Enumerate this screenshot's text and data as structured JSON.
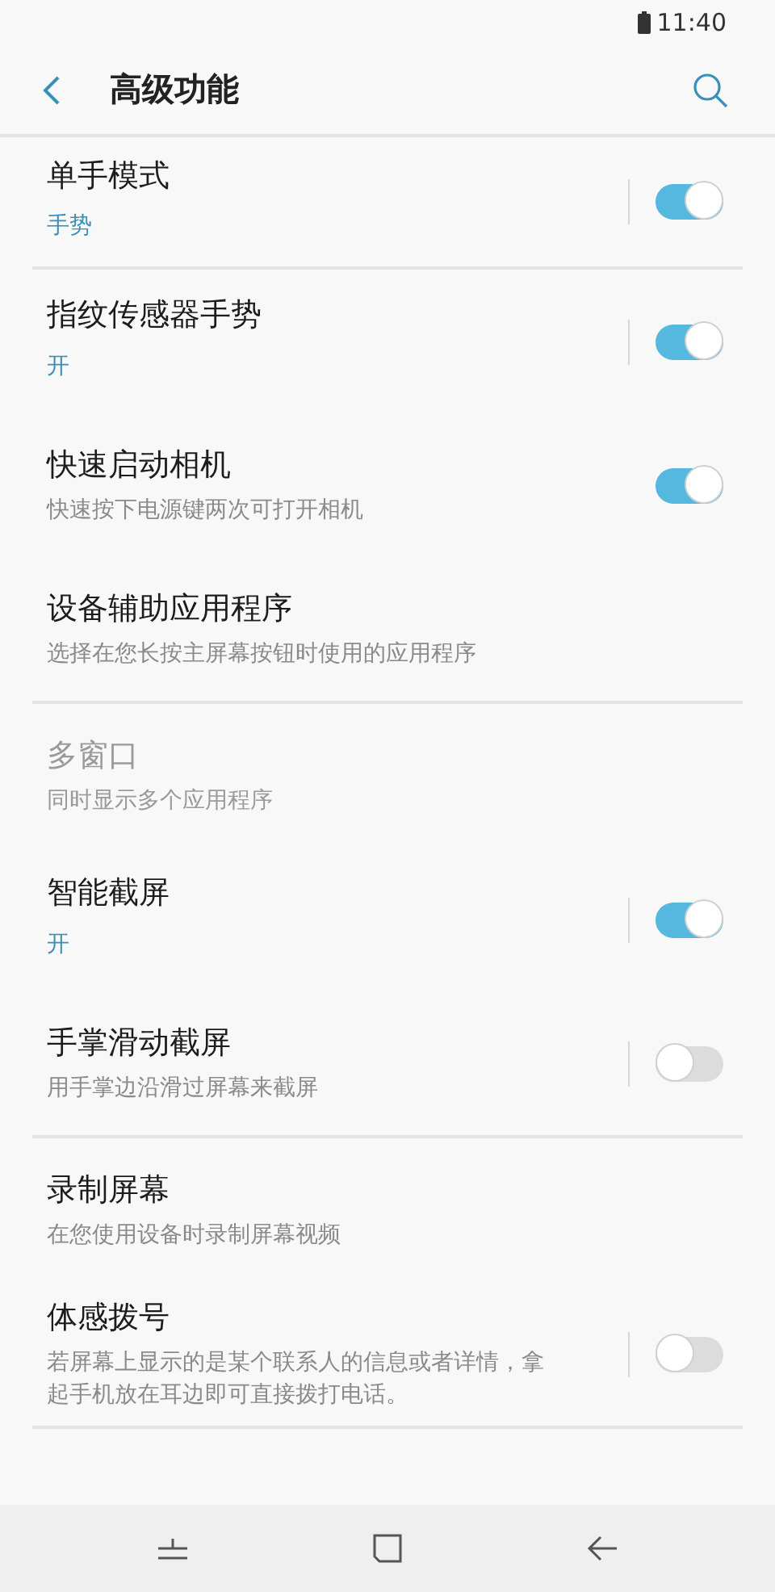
{
  "status_bar": {
    "time": "11:40"
  },
  "header": {
    "title": "高级功能"
  },
  "settings": [
    {
      "kind": "switch",
      "title": "单手模式",
      "subtitle": "手势",
      "subtitle_highlighted": true,
      "split": true,
      "on": true,
      "disabled": false,
      "divider_after": true
    },
    {
      "kind": "switch",
      "title": "指纹传感器手势",
      "subtitle": "开",
      "subtitle_highlighted": true,
      "split": true,
      "on": true,
      "disabled": false,
      "divider_after": false
    },
    {
      "kind": "switch",
      "title": "快速启动相机",
      "subtitle": "快速按下电源键两次可打开相机",
      "subtitle_highlighted": false,
      "split": false,
      "on": true,
      "disabled": false,
      "divider_after": false
    },
    {
      "kind": "plain",
      "title": "设备辅助应用程序",
      "subtitle": "选择在您长按主屏幕按钮时使用的应用程序",
      "subtitle_highlighted": false,
      "split": false,
      "disabled": false,
      "divider_after": true
    },
    {
      "kind": "plain",
      "title": "多窗口",
      "subtitle": "同时显示多个应用程序",
      "subtitle_highlighted": false,
      "split": false,
      "disabled": true,
      "divider_after": false
    },
    {
      "kind": "switch",
      "title": "智能截屏",
      "subtitle": "开",
      "subtitle_highlighted": true,
      "split": true,
      "on": true,
      "disabled": false,
      "divider_after": false
    },
    {
      "kind": "switch",
      "title": "手掌滑动截屏",
      "subtitle": "用手掌边沿滑过屏幕来截屏",
      "subtitle_highlighted": false,
      "split": true,
      "on": false,
      "disabled": false,
      "divider_after": true
    },
    {
      "kind": "plain",
      "title": "录制屏幕",
      "subtitle": "在您使用设备时录制屏幕视频",
      "subtitle_highlighted": false,
      "split": false,
      "disabled": false,
      "divider_after": false
    },
    {
      "kind": "switch",
      "title": "体感拨号",
      "subtitle": "若屏幕上显示的是某个联系人的信息或者详情，拿起手机放在耳边即可直接拨打电话。",
      "subtitle_highlighted": false,
      "split": true,
      "on": false,
      "disabled": false,
      "divider_after": true
    }
  ]
}
